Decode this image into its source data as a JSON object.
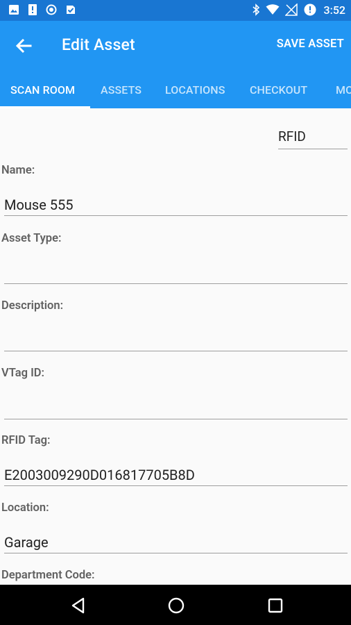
{
  "status_bar": {
    "time": "3:52",
    "left_icons": [
      "image-icon",
      "sim-alert-icon",
      "record-icon",
      "download-done-icon"
    ],
    "right_icons": [
      "bluetooth-icon",
      "wifi-icon",
      "no-signal-icon",
      "data-saver-icon"
    ]
  },
  "app_bar": {
    "title": "Edit Asset",
    "save_label": "SAVE ASSET",
    "back_icon": "arrow-back-icon"
  },
  "tabs": [
    {
      "label": "SCAN ROOM",
      "active": true
    },
    {
      "label": "ASSETS",
      "active": false
    },
    {
      "label": "LOCATIONS",
      "active": false
    },
    {
      "label": "CHECKOUT",
      "active": false
    },
    {
      "label": "MO",
      "active": false
    }
  ],
  "rfid_selector": {
    "value": "RFID"
  },
  "form": {
    "name": {
      "label": "Name:",
      "value": "Mouse 555"
    },
    "asset_type": {
      "label": "Asset Type:",
      "value": ""
    },
    "description": {
      "label": "Description:",
      "value": ""
    },
    "vtag_id": {
      "label": "VTag ID:",
      "value": ""
    },
    "rfid_tag": {
      "label": "RFID Tag:",
      "value": "E2003009290D016817705B8D"
    },
    "location": {
      "label": "Location:",
      "value": "Garage"
    },
    "department_code": {
      "label": "Department Code:"
    }
  },
  "nav_bar": {
    "back_icon": "nav-back-icon",
    "home_icon": "nav-home-icon",
    "recents_icon": "nav-recents-icon"
  },
  "colors": {
    "status_bar": "#1976d2",
    "app_bar": "#2196f3",
    "background": "#fafafa",
    "label_text": "#616161",
    "value_text": "#212121"
  }
}
